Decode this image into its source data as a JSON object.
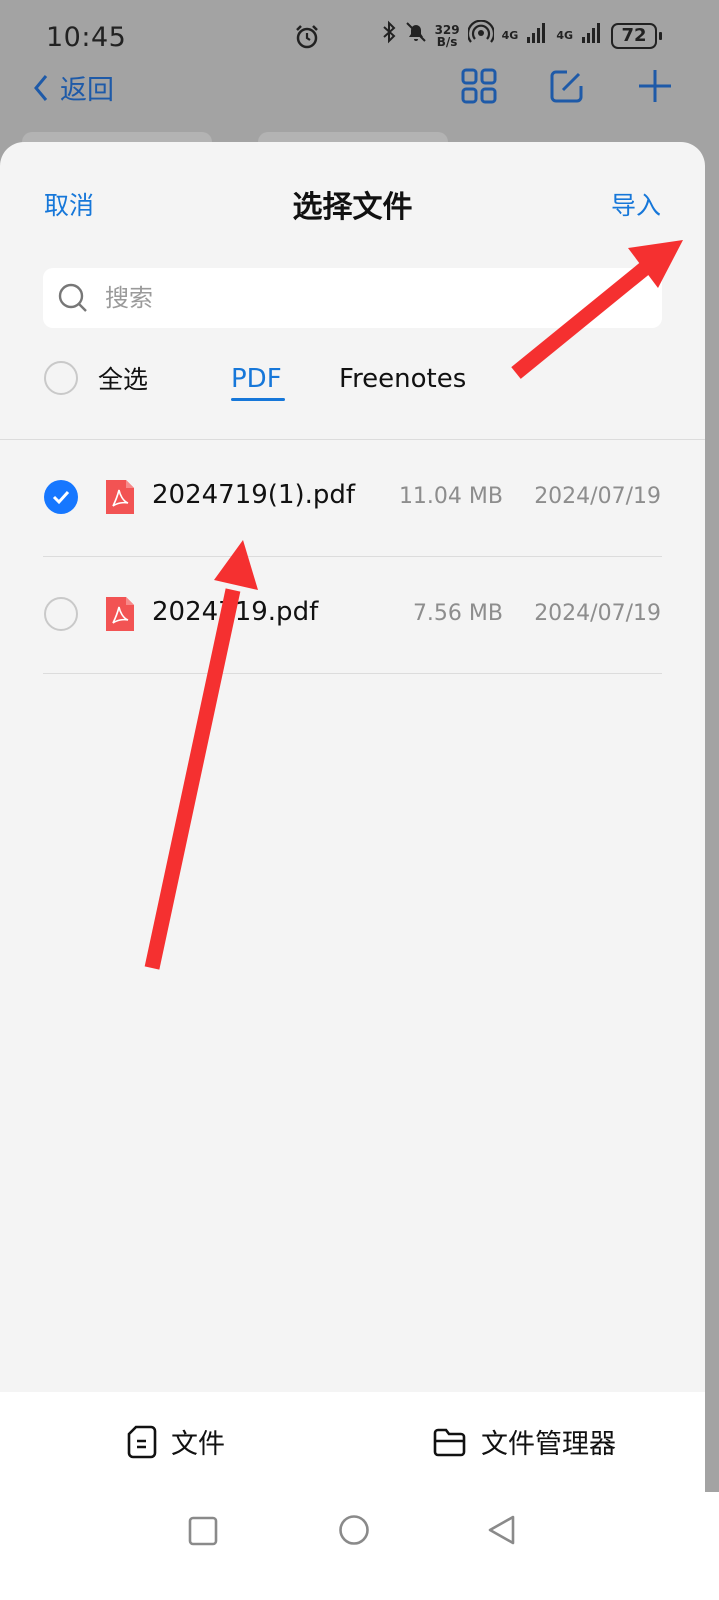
{
  "status_bar": {
    "time": "10:45",
    "speed_value": "329",
    "speed_unit": "B/s",
    "network_1": "4G",
    "network_2": "4G",
    "battery": "72"
  },
  "top_nav": {
    "back_label": "返回"
  },
  "sheet": {
    "cancel_label": "取消",
    "title": "选择文件",
    "import_label": "导入",
    "search_placeholder": "搜索",
    "select_all_label": "全选",
    "tabs": [
      {
        "label": "PDF",
        "active": true
      },
      {
        "label": "Freenotes",
        "active": false
      }
    ],
    "files": [
      {
        "name": "2024719(1).pdf",
        "size": "11.04 MB",
        "date": "2024/07/19",
        "checked": true
      },
      {
        "name": "2024719.pdf",
        "size": "7.56 MB",
        "date": "2024/07/19",
        "checked": false
      }
    ],
    "footer": {
      "files_label": "文件",
      "manager_label": "文件管理器"
    }
  },
  "colors": {
    "accent": "#1677d9",
    "check": "#1677ff",
    "pdf_icon": "#f25353",
    "annotation_arrow": "#f53030"
  }
}
